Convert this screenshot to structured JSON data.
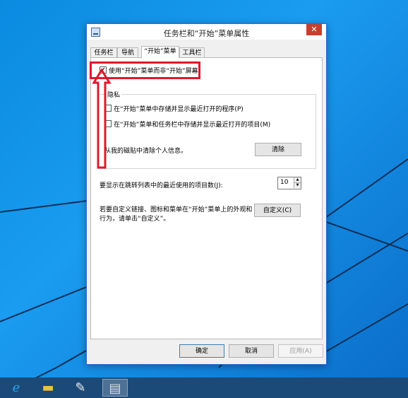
{
  "dialog": {
    "title": "任务栏和“开始”菜单属性",
    "close": "✕"
  },
  "tabs": [
    {
      "label": "任务栏"
    },
    {
      "label": "导航"
    },
    {
      "label": "“开始”菜单"
    },
    {
      "label": "工具栏"
    }
  ],
  "start_menu": {
    "use_start_menu_label": "使用“开始”菜单而非“开始”屏幕",
    "use_start_menu_checked": "✔",
    "privacy_group_title": "隐私",
    "store_recent_programs_label": "在“开始”菜单中存储并显示最近打开的程序(P)",
    "store_recent_items_label": "在“开始”菜单和任务栏中存储并显示最近打开的项目(M)",
    "clear_tiles_label": "从我的磁贴中清除个人信息。",
    "clear_button": "清除",
    "jump_list_label": "要显示在跳转列表中的最近使用的项目数(J):",
    "jump_list_value": "10",
    "customize_text_line1": "若要自定义链接、图标和菜单在“开始”菜单上的外观和",
    "customize_text_line2": "行为，请单击“自定义”。",
    "customize_button": "自定义(C)"
  },
  "footer": {
    "ok": "确定",
    "cancel": "取消",
    "apply": "应用(A)"
  },
  "taskbar": {
    "items": [
      {
        "icon": "ie-icon",
        "glyph": "e"
      },
      {
        "icon": "file-explorer-icon",
        "glyph": "▬"
      },
      {
        "icon": "paint-icon",
        "glyph": "✎"
      },
      {
        "icon": "active-window-icon",
        "glyph": "▤"
      }
    ]
  },
  "colors": {
    "highlight": "#e0182d",
    "desktop": "#0a8be0",
    "close": "#c7402e"
  }
}
